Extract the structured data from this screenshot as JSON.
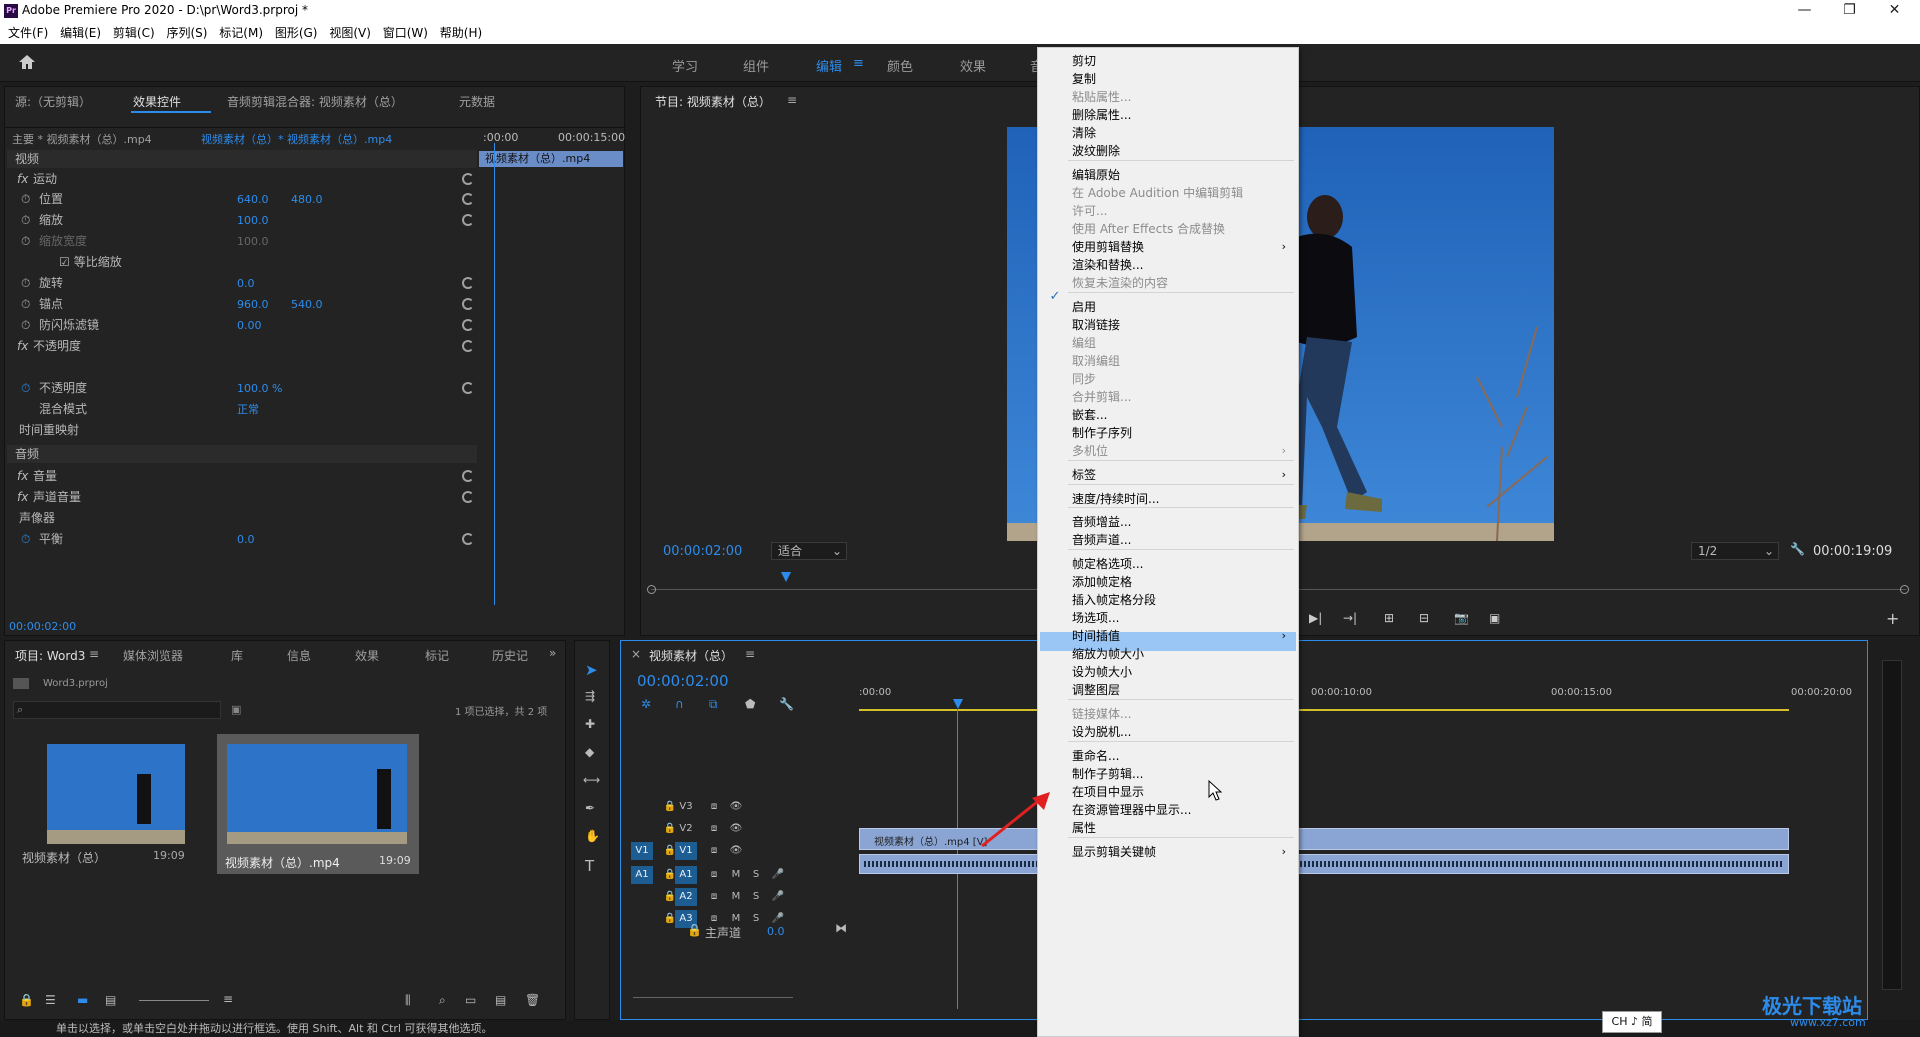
{
  "window": {
    "title": "Adobe Premiere Pro 2020 - D:\\pr\\Word3.prproj *",
    "app_icon": "Pr",
    "min": "—",
    "max": "❐",
    "close": "✕"
  },
  "menubar": [
    "文件(F)",
    "编辑(E)",
    "剪辑(C)",
    "序列(S)",
    "标记(M)",
    "图形(G)",
    "视图(V)",
    "窗口(W)",
    "帮助(H)"
  ],
  "workspaces": [
    "学习",
    "组件",
    "编辑",
    "颜色",
    "效果",
    "音"
  ],
  "effects": {
    "tabs": [
      "源:（无剪辑）",
      "效果控件",
      "音频剪辑混合器: 视频素材（总）",
      "元数据"
    ],
    "clip_path": "主要 * 视频素材（总）.mp4",
    "clip_seq": "视频素材（总）* 视频素材（总）.mp4",
    "time_start": ":00:00",
    "time_end": "00:00:15:00",
    "clip_bar": "视频素材（总）.mp4",
    "section_video": "视频",
    "section_audio": "音频",
    "rows": [
      {
        "label": "运动",
        "v1": "",
        "v2": ""
      },
      {
        "label": "位置",
        "v1": "640.0",
        "v2": "480.0"
      },
      {
        "label": "缩放",
        "v1": "100.0",
        "v2": ""
      },
      {
        "label": "缩放宽度",
        "v1": "100.0",
        "v2": ""
      },
      {
        "label": "等比缩放",
        "v1": "",
        "v2": ""
      },
      {
        "label": "旋转",
        "v1": "0.0",
        "v2": ""
      },
      {
        "label": "锚点",
        "v1": "960.0",
        "v2": "540.0"
      },
      {
        "label": "防闪烁滤镜",
        "v1": "0.00",
        "v2": ""
      },
      {
        "label": "不透明度",
        "v1": "",
        "v2": ""
      },
      {
        "label": "不透明度",
        "v1": "100.0 %",
        "v2": ""
      },
      {
        "label": "混合模式",
        "v1": "正常",
        "v2": ""
      },
      {
        "label": "时间重映射",
        "v1": "",
        "v2": ""
      },
      {
        "label": "音量",
        "v1": "",
        "v2": ""
      },
      {
        "label": "声道音量",
        "v1": "",
        "v2": ""
      },
      {
        "label": "声像器",
        "v1": "",
        "v2": ""
      },
      {
        "label": "平衡",
        "v1": "0.0",
        "v2": ""
      }
    ],
    "timecode": "00:00:02:00"
  },
  "program": {
    "title": "节目: 视频素材（总）",
    "timecode": "00:00:02:00",
    "fit": "适合",
    "ratio": "1/2",
    "duration": "00:00:19:09"
  },
  "project": {
    "tabs": [
      "项目: Word3",
      "媒体浏览器",
      "库",
      "信息",
      "效果",
      "标记",
      "历史记"
    ],
    "file": "Word3.prproj",
    "selection": "1 项已选择，共 2 项",
    "items": [
      {
        "name": "视频素材（总）",
        "dur": "19:09"
      },
      {
        "name": "视频素材（总）.mp4",
        "dur": "19:09"
      }
    ]
  },
  "timeline": {
    "title": "视频素材（总）",
    "timecode": "00:00:02:00",
    "ruler": [
      ":00:00",
      "00:00:10:00",
      "00:00:15:00",
      "00:00:20:00"
    ],
    "tracks": [
      {
        "id": "V3"
      },
      {
        "id": "V2"
      },
      {
        "id": "V1",
        "src": "V1"
      },
      {
        "id": "A1",
        "src": "A1"
      },
      {
        "id": "A2"
      },
      {
        "id": "A3"
      }
    ],
    "master": "主声道",
    "master_val": "0.0",
    "clip_label": "视频素材（总）.mp4 [V]"
  },
  "context_menu": [
    {
      "label": "剪切",
      "dis": false
    },
    {
      "label": "复制",
      "dis": false
    },
    {
      "label": "粘贴属性...",
      "dis": true
    },
    {
      "label": "删除属性...",
      "dis": false
    },
    {
      "label": "清除",
      "dis": false
    },
    {
      "label": "波纹删除",
      "dis": false
    },
    {
      "label": "编辑原始",
      "dis": false
    },
    {
      "label": "在 Adobe Audition 中编辑剪辑",
      "dis": true
    },
    {
      "label": "许可...",
      "dis": true
    },
    {
      "label": "使用 After Effects 合成替换",
      "dis": true
    },
    {
      "label": "使用剪辑替换",
      "dis": false
    },
    {
      "label": "渲染和替换...",
      "dis": false
    },
    {
      "label": "恢复未渲染的内容",
      "dis": true
    },
    {
      "label": "启用",
      "dis": false
    },
    {
      "label": "取消链接",
      "dis": false
    },
    {
      "label": "编组",
      "dis": true
    },
    {
      "label": "取消编组",
      "dis": true
    },
    {
      "label": "同步",
      "dis": true
    },
    {
      "label": "合并剪辑...",
      "dis": true
    },
    {
      "label": "嵌套...",
      "dis": false
    },
    {
      "label": "制作子序列",
      "dis": false
    },
    {
      "label": "多机位",
      "dis": true
    },
    {
      "label": "标签",
      "dis": false
    },
    {
      "label": "速度/持续时间...",
      "dis": false
    },
    {
      "label": "音频增益...",
      "dis": false
    },
    {
      "label": "音频声道...",
      "dis": false
    },
    {
      "label": "帧定格选项...",
      "dis": false
    },
    {
      "label": "添加帧定格",
      "dis": false
    },
    {
      "label": "插入帧定格分段",
      "dis": false
    },
    {
      "label": "场选项...",
      "dis": false
    },
    {
      "label": "时间插值",
      "dis": false
    },
    {
      "label": "缩放为帧大小",
      "dis": false
    },
    {
      "label": "设为帧大小",
      "dis": false
    },
    {
      "label": "调整图层",
      "dis": false
    },
    {
      "label": "链接媒体...",
      "dis": true
    },
    {
      "label": "设为脱机...",
      "dis": false
    },
    {
      "label": "重命名...",
      "dis": false
    },
    {
      "label": "制作子剪辑...",
      "dis": false
    },
    {
      "label": "在项目中显示",
      "dis": false
    },
    {
      "label": "在资源管理器中显示...",
      "dis": false
    },
    {
      "label": "属性",
      "dis": false
    },
    {
      "label": "显示剪辑关键帧",
      "dis": false
    }
  ],
  "status": "单击以选择，或单击空白处并拖动以进行框选。使用 Shift、Alt 和 Ctrl 可获得其他选项。",
  "ime": "CH ♪ 简",
  "watermark": "极光下载站",
  "watermark_url": "www.xz7.com"
}
